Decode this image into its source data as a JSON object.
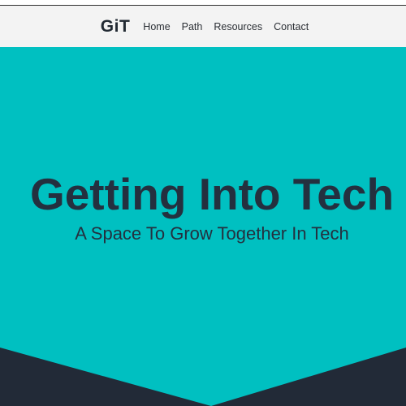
{
  "header": {
    "logo": "GiT",
    "nav": [
      {
        "label": "Home"
      },
      {
        "label": "Path"
      },
      {
        "label": "Resources"
      },
      {
        "label": "Contact"
      }
    ]
  },
  "hero": {
    "title": "Getting Into Tech",
    "subtitle": "A Space To Grow Together In Tech"
  },
  "colors": {
    "navbar_bg": "#f3f3f3",
    "hero_bg": "#00c0c1",
    "dark": "#24303f",
    "chevron": "#222a37"
  }
}
